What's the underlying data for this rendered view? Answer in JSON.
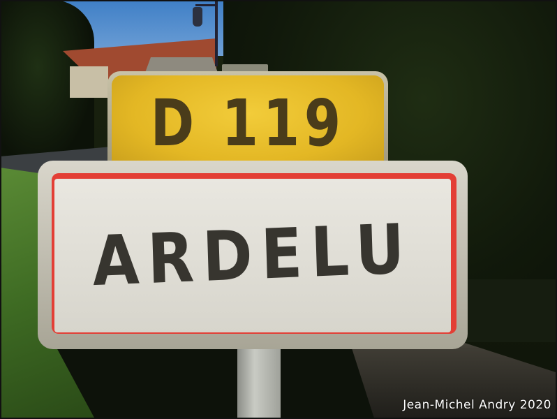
{
  "photo": {
    "route_sign": "D 119",
    "town_sign": "ARDELU",
    "credit": "Jean-Michel Andry 2020"
  },
  "colors": {
    "route_sign_yellow": "#e3b724",
    "town_sign_red": "#e33e35",
    "town_sign_white": "#e4e2db",
    "text_dark": "#37352f"
  }
}
